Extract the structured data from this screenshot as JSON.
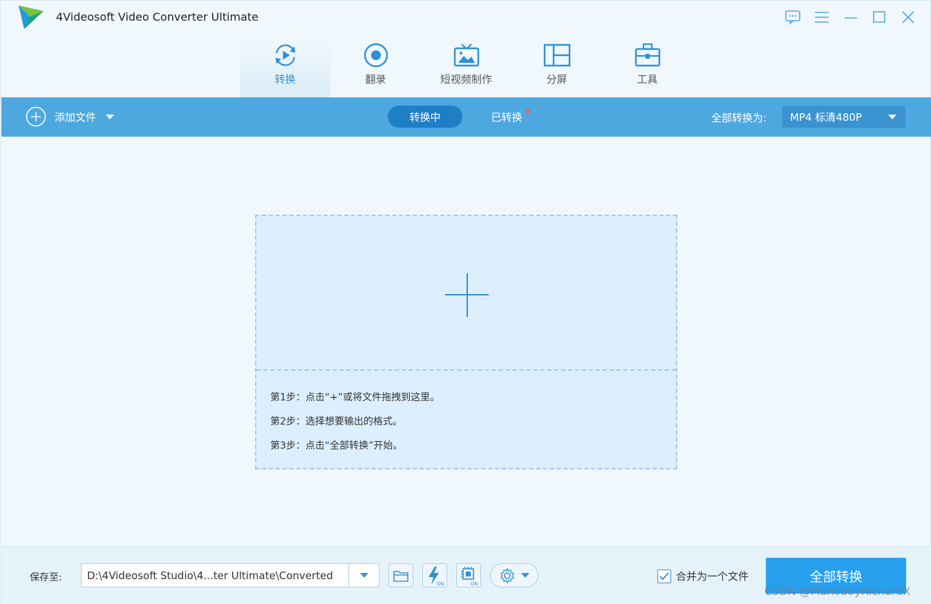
{
  "window": {
    "title": "4Videosoft Video Converter Ultimate"
  },
  "modules": [
    {
      "label": "转换",
      "icon": "convert-icon",
      "active": true
    },
    {
      "label": "翻录",
      "icon": "ripper-disc-icon",
      "active": false
    },
    {
      "label": "短视频制作",
      "icon": "mv-tv-icon",
      "active": false
    },
    {
      "label": "分屏",
      "icon": "collage-icon",
      "active": false
    },
    {
      "label": "工具",
      "icon": "toolbox-icon",
      "active": false
    }
  ],
  "toolbar": {
    "add_file": "添加文件",
    "tab_converting": "转换中",
    "tab_converted": "已转换",
    "convert_all_to": "全部转换为:",
    "format": "MP4 标清480P"
  },
  "dropzone": {
    "steps": [
      "第1步：点击“+”或将文件拖拽到这里。",
      "第2步：选择想要输出的格式。",
      "第3步：点击“全部转换”开始。"
    ]
  },
  "footer": {
    "save_to": "保存至:",
    "path": "D:\\4Videosoft Studio\\4...ter Ultimate\\Converted",
    "merge_label": "合并为一个文件",
    "merge_checked": true,
    "convert_all": "全部转换",
    "watermark": "CSDN @PianoboyRichardX"
  },
  "colors": {
    "accent": "#4ea8e0",
    "accent_dark": "#1f7fc5",
    "button": "#28a0ee",
    "badge": "#ff5a4a"
  }
}
